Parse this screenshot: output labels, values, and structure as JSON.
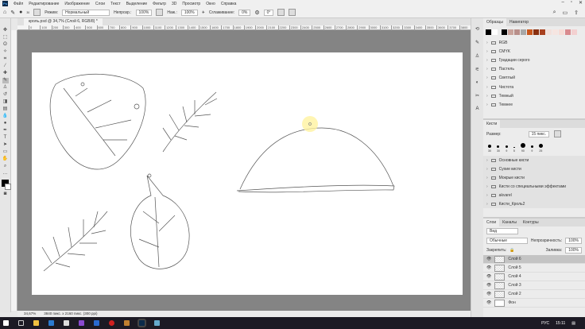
{
  "menu": [
    "Файл",
    "Редактирование",
    "Изображение",
    "Слои",
    "Текст",
    "Выделение",
    "Фильтр",
    "3D",
    "Просмотр",
    "Окно",
    "Справка"
  ],
  "app_logo": "Ps",
  "options": {
    "brush_size": "30",
    "mode_label": "Режим:",
    "mode": "Нормальный",
    "opacity_label": "Непрозр.:",
    "opacity": "100%",
    "flow_label": "Наж.:",
    "flow": "100%",
    "smoothing_label": "Сглаживание:",
    "smoothing": "0%",
    "angle": "0°"
  },
  "document": {
    "tab": "кроль.psd @ 34,7% (Слой 6, RGB/8) *"
  },
  "ruler": [
    "0",
    "100",
    "200",
    "300",
    "400",
    "500",
    "600",
    "700",
    "800",
    "900",
    "1000",
    "1100",
    "1200",
    "1300",
    "1400",
    "1500",
    "1600",
    "1700",
    "1800",
    "1900",
    "2000",
    "2100",
    "2200",
    "2300",
    "2400",
    "2500",
    "2600",
    "2700",
    "2800",
    "2900",
    "3000",
    "3100",
    "3200",
    "3300",
    "3400",
    "3500",
    "3600",
    "3700",
    "3800"
  ],
  "status": {
    "zoom": "34,67%",
    "size": "3840 пикс. x 2160 пикс. (300 ppi)"
  },
  "swatches": {
    "tabs": [
      "Образцы",
      "Навигатор"
    ],
    "colors": [
      "#000000",
      "#ffffff",
      "#000000",
      "#c9a39b",
      "#b98f8a",
      "#a8a8a8",
      "#c8561c",
      "#8a2f0e",
      "#a8401e",
      "#f3e1dc",
      "#f6e5e1",
      "#f7dcd6",
      "#d98b8f",
      "#f3d0d0"
    ],
    "groups": [
      "RGB",
      "CMYK",
      "Градации серого",
      "Пастель",
      "Светлый",
      "Чистота",
      "Темный",
      "Темнее"
    ]
  },
  "brushes": {
    "title": "Кисти",
    "size_label": "Размер:",
    "size": "15 пикс.",
    "presets": [
      "30",
      "30",
      "9",
      "5",
      "90",
      "9",
      "25"
    ],
    "groups": [
      "Основные кисти",
      "Сухие кисти",
      "Мокрые кисти",
      "Кисти со специальными эффектами",
      "akvarel",
      "Кисти_Кроль2"
    ]
  },
  "layers": {
    "tabs": [
      "Слои",
      "Каналы",
      "Контуры"
    ],
    "filter": "Вид",
    "blend": "Обычные",
    "opacity_label": "Непрозрачность:",
    "opacity": "100%",
    "lock_label": "Закрепить:",
    "fill_label": "Заливка:",
    "fill": "100%",
    "items": [
      "Слой 6",
      "Слой 5",
      "Слой 4",
      "Слой 3",
      "Слой 2",
      "Фон"
    ]
  },
  "taskbar": {
    "lang": "РУС",
    "time": "15:11"
  }
}
